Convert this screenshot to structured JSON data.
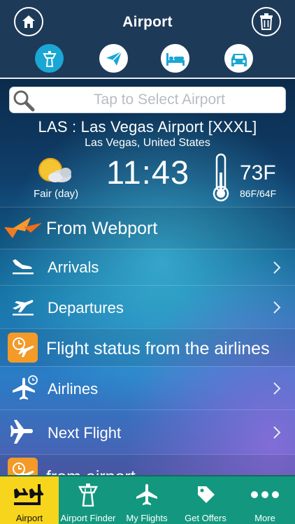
{
  "header": {
    "title": "Airport",
    "home_icon": "home-icon",
    "delete_icon": "trash-icon",
    "category_tabs": [
      {
        "icon": "control-tower-icon",
        "active": true
      },
      {
        "icon": "paper-plane-icon",
        "active": false
      },
      {
        "icon": "bed-icon",
        "active": false
      },
      {
        "icon": "car-icon",
        "active": false
      }
    ]
  },
  "search": {
    "placeholder": "Tap to Select Airport",
    "value": ""
  },
  "airport": {
    "name": "LAS : Las Vegas Airport [XXXL]",
    "location": "Las Vegas, United States"
  },
  "weather": {
    "condition": "Fair (day)",
    "time": "11:43",
    "temperature": "73F",
    "range": "86F/64F"
  },
  "list": {
    "section_webport": "From Webport",
    "arrivals": "Arrivals",
    "departures": "Departures",
    "section_airlines": "Flight status from the airlines",
    "airlines": "Airlines",
    "next_flight": "Next Flight",
    "section_airport": "from airport"
  },
  "tabbar": {
    "items": [
      {
        "label": "Airport",
        "icon": "airport-icon",
        "active": true
      },
      {
        "label": "Airport Finder",
        "icon": "control-tower-icon",
        "active": false
      },
      {
        "label": "My Flights",
        "icon": "airplane-icon",
        "active": false
      },
      {
        "label": "Get Offers",
        "icon": "tag-icon",
        "active": false
      },
      {
        "label": "More",
        "icon": "more-icon",
        "active": false
      }
    ]
  },
  "colors": {
    "header": "#1d3a58",
    "accent_blue": "#1aa7d6",
    "orange": "#f39a29",
    "tabbar": "#13987f",
    "tab_active": "#f7d51d"
  }
}
